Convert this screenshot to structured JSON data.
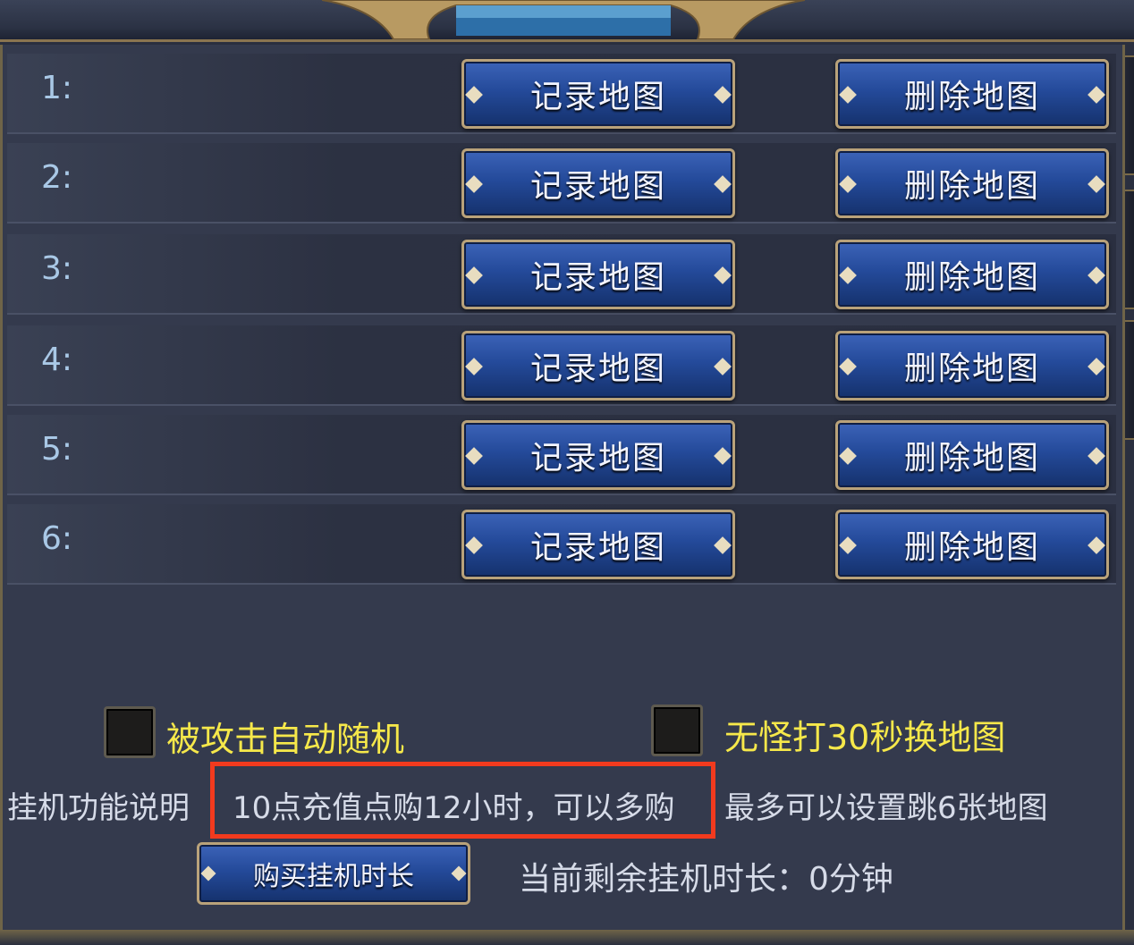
{
  "map_slots": [
    {
      "label": "1:",
      "record_label": "记录地图",
      "delete_label": "删除地图"
    },
    {
      "label": "2:",
      "record_label": "记录地图",
      "delete_label": "删除地图"
    },
    {
      "label": "3:",
      "record_label": "记录地图",
      "delete_label": "删除地图"
    },
    {
      "label": "4:",
      "record_label": "记录地图",
      "delete_label": "删除地图"
    },
    {
      "label": "5:",
      "record_label": "记录地图",
      "delete_label": "删除地图"
    },
    {
      "label": "6:",
      "record_label": "记录地图",
      "delete_label": "删除地图"
    }
  ],
  "options": {
    "auto_random_on_attack": {
      "label": "被攻击自动随机",
      "checked": false
    },
    "switch_map_no_monster": {
      "label": "无怪打30秒换地图",
      "checked": false
    }
  },
  "info": {
    "help_label": "挂机功能说明",
    "recharge_note": "10点充值点购12小时，可以多购",
    "max_maps_note": "最多可以设置跳6张地图"
  },
  "footer": {
    "buy_button_label": "购买挂机时长",
    "remaining_time": "当前剩余挂机时长：0分钟"
  },
  "colors": {
    "highlight": "#f23a1e",
    "option_text": "#f6e84a",
    "button_blue": "#244a9a"
  }
}
